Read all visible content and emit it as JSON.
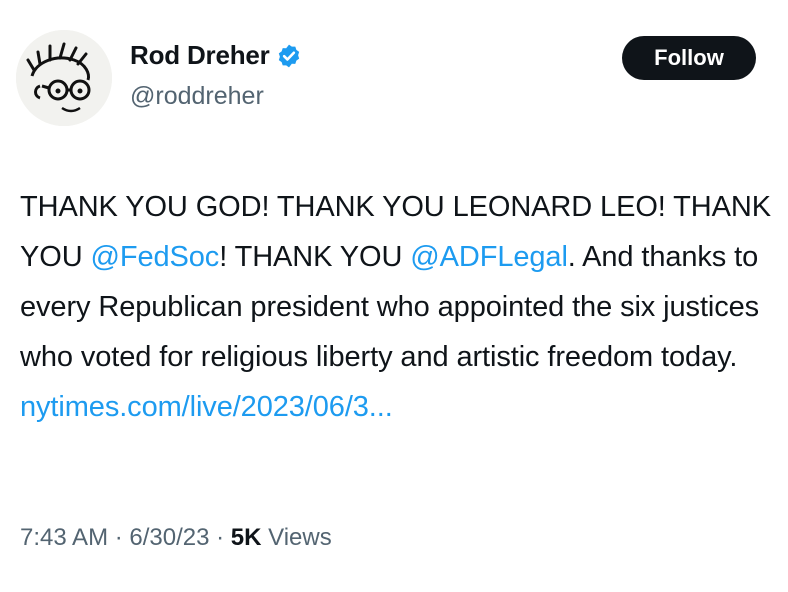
{
  "author": {
    "display_name": "Rod Dreher",
    "handle": "@roddreher",
    "verified_icon": "verified-badge-icon",
    "avatar_icon": "avatar-caricature"
  },
  "follow_button": {
    "label": "Follow"
  },
  "tweet": {
    "segments": [
      {
        "text": "THANK YOU GOD! THANK YOU LEONARD LEO! THANK YOU ",
        "type": "text"
      },
      {
        "text": "@FedSoc",
        "type": "mention"
      },
      {
        "text": "! THANK YOU ",
        "type": "text"
      },
      {
        "text": "@ADFLegal",
        "type": "mention"
      },
      {
        "text": ". And thanks to every Republican president who appointed the six justices who voted for religious liberty and artistic freedom today. ",
        "type": "text"
      },
      {
        "text": "nytimes.com/live/2023/06/3...",
        "type": "link"
      }
    ]
  },
  "meta": {
    "time": "7:43 AM",
    "separator": " · ",
    "date": "6/30/23",
    "views_count": "5K",
    "views_label": " Views"
  },
  "colors": {
    "link": "#1d9bf0",
    "text": "#0f1419",
    "muted": "#536471",
    "button_bg": "#0f1419"
  }
}
